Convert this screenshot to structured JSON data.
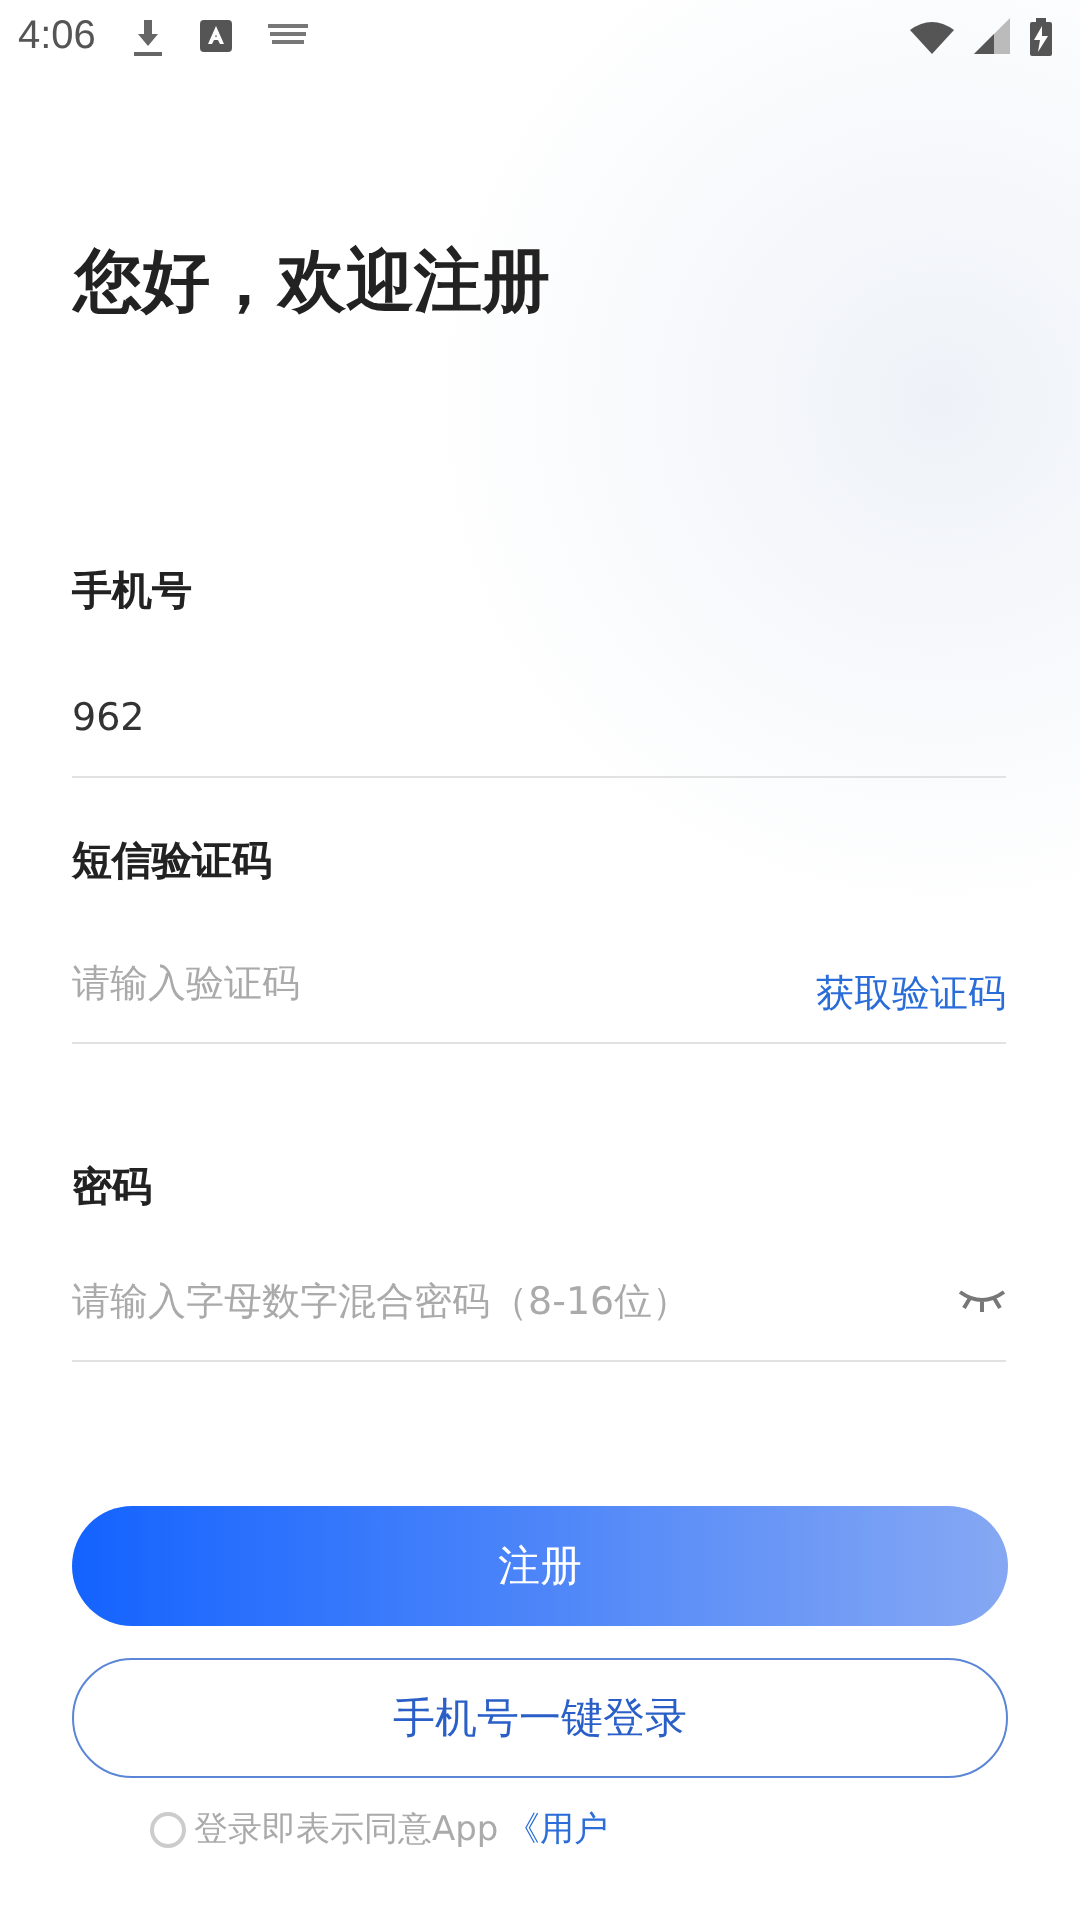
{
  "status_bar": {
    "time": "4:06"
  },
  "title": "您好，欢迎注册",
  "fields": [
    {
      "label": "手机号",
      "value": "962"
    },
    {
      "label": "短信验证码",
      "placeholder": "请输入验证码",
      "action": "获取验证码"
    },
    {
      "label": "密码",
      "placeholder": "请输入字母数字混合密码（8-16位）",
      "password_hidden": true
    }
  ],
  "primary_button": "注册",
  "secondary_button": "手机号一键登录",
  "agreement": {
    "checked": false,
    "text": "登录即表示同意App",
    "link": "《用户"
  }
}
